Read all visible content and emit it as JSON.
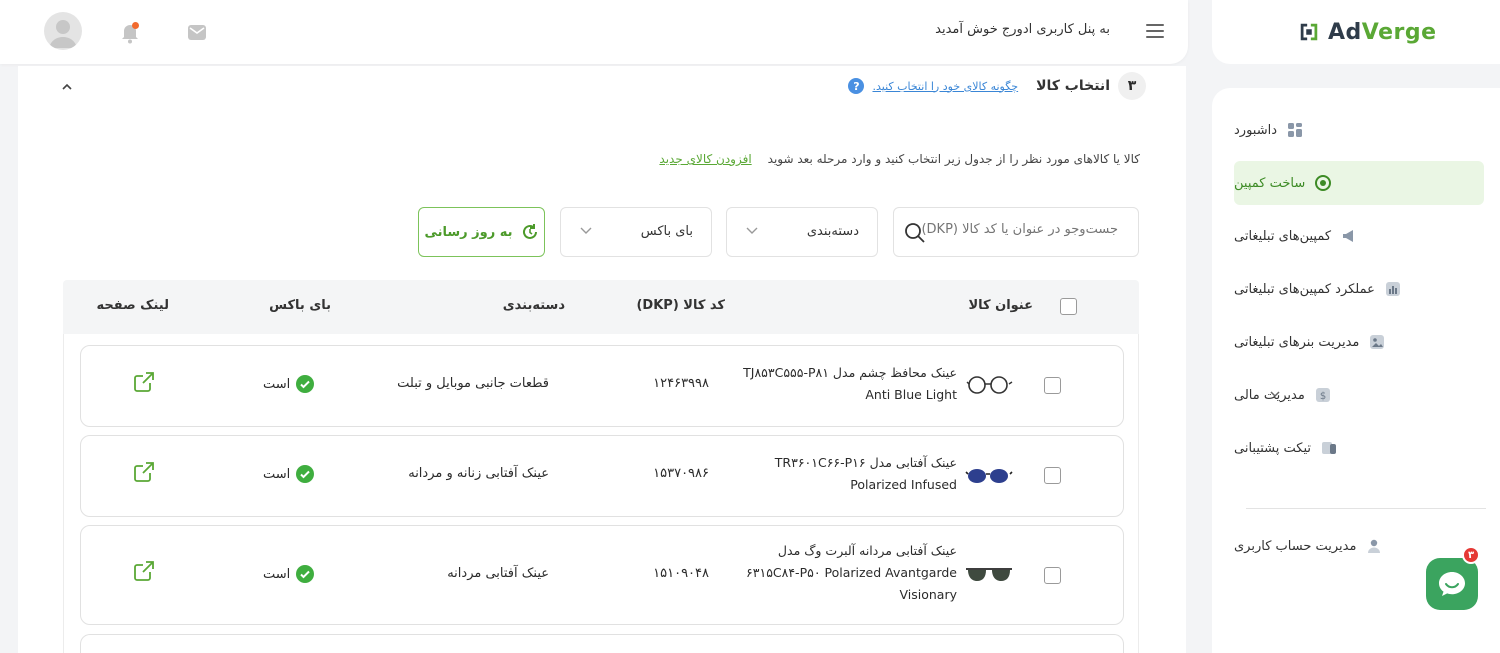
{
  "brand": {
    "name_a": "Ad",
    "name_b": "Verge"
  },
  "header": {
    "welcome": "به پنل کاربری ادورج خوش آمدید"
  },
  "sidebar": {
    "items": [
      {
        "label": "داشبورد",
        "icon": "dashboard-icon"
      },
      {
        "label": "ساخت کمپین",
        "icon": "campaign-create-icon",
        "active": true
      },
      {
        "label": "کمپین‌های تبلیغاتی",
        "icon": "megaphone-icon"
      },
      {
        "label": "عملکرد کمپین‌های تبلیغاتی",
        "icon": "chart-icon"
      },
      {
        "label": "مدیریت بنرهای تبلیغاتی",
        "icon": "image-icon"
      },
      {
        "label": "مدیریت مالی",
        "icon": "money-icon",
        "has_children": true
      },
      {
        "label": "تیکت پشتیبانی",
        "icon": "ticket-icon"
      },
      {
        "label": "مدیریت حساب کاربری",
        "icon": "user-icon"
      }
    ]
  },
  "step": {
    "number": "۳",
    "title": "انتخاب کالا",
    "help_link": "چگونه کالای خود را انتخاب کنید.",
    "help_icon": "?"
  },
  "instruction": {
    "text": "کالا یا کالاهای مورد نظر را از جدول زیر انتخاب کنید و وارد مرحله بعد شوید",
    "add_link": "افزودن کالای جدید"
  },
  "filters": {
    "search_placeholder": "جست‌وجو در عنوان یا کد کالا (DKP)",
    "category": "دسته‌بندی",
    "buybox": "بای باکس",
    "refresh": "به روز رسانی"
  },
  "table": {
    "headers": {
      "title": "عنوان کالا",
      "dkp": "کد کالا (DKP)",
      "category": "دسته‌بندی",
      "buybox": "بای باکس",
      "link": "لینک صفحه"
    },
    "rows": [
      {
        "title_line1": "عینک محافظ چشم مدل TJ۸۵۳C۵۵۵-P۸۱",
        "title_line2": "Anti Blue Light",
        "dkp": "۱۲۴۶۳۹۹۸",
        "category": "قطعات جانبی موبایل و تبلت",
        "buybox": "است"
      },
      {
        "title_line1": "عینک آفتابی مدل TR۳۶۰۱C۶۶-P۱۶",
        "title_line2": "Polarized Infused",
        "dkp": "۱۵۳۷۰۹۸۶",
        "category": "عینک آفتابی زنانه و مردانه",
        "buybox": "است"
      },
      {
        "title_line1": "عینک آفتابی مردانه آلبرت وگ مدل",
        "title_line2": "۶۳۱۵C۸۴-P۵۰ Polarized Avantgarde",
        "title_line3": "Visionary",
        "dkp": "۱۵۱۰۹۰۴۸",
        "category": "عینک آفتابی مردانه",
        "buybox": "است"
      }
    ]
  },
  "chat": {
    "badge": "۳"
  },
  "colors": {
    "accent": "#5aa835",
    "link": "#3a86d6",
    "badge": "#e53935",
    "chat": "#3ba45f"
  }
}
